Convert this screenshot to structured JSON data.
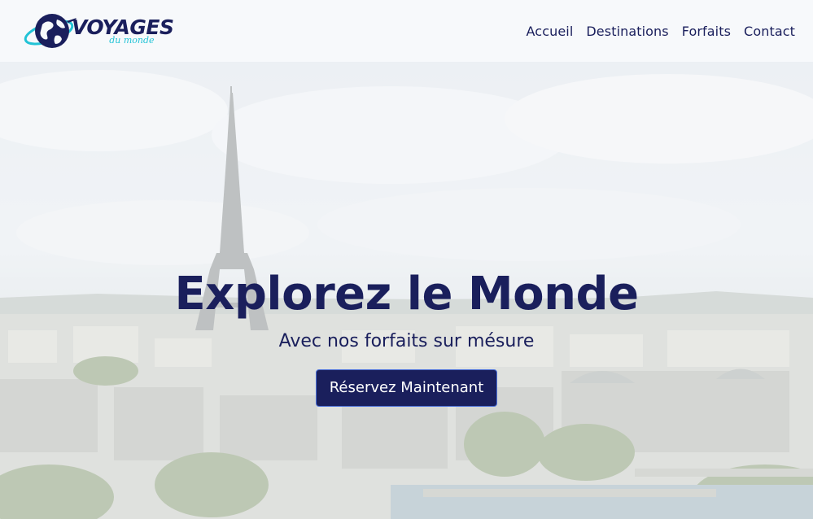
{
  "header": {
    "logo": {
      "title": "VOYAGES",
      "subtitle": "du monde"
    },
    "nav": [
      {
        "label": "Accueil"
      },
      {
        "label": "Destinations"
      },
      {
        "label": "Forfaits"
      },
      {
        "label": "Contact"
      }
    ]
  },
  "hero": {
    "title": "Explorez le Monde",
    "subtitle": "Avec nos forfaits sur mésure",
    "cta_label": "Réservez Maintenant",
    "background": "paris-eiffel-tower-cityscape"
  },
  "colors": {
    "navy": "#1a1f5c",
    "accent_cyan": "#22c3d6",
    "header_bg": "#f7f9fb"
  }
}
